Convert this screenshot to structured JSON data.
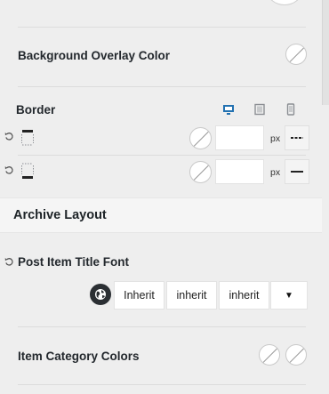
{
  "background_overlay": {
    "label": "Background Overlay Color"
  },
  "border": {
    "label": "Border",
    "devices": [
      "desktop-icon",
      "tablet-icon",
      "mobile-icon"
    ],
    "rows": [
      {
        "unit": "px",
        "style": "dashed"
      },
      {
        "unit": "px",
        "style": "solid"
      }
    ]
  },
  "archive_layout": {
    "title": "Archive Layout"
  },
  "post_item_title_font": {
    "label": "Post Item Title Font",
    "family": "Inherit",
    "weight": "inherit",
    "size": "inherit",
    "dropdown_icon": "▼"
  },
  "item_category_colors": {
    "label": "Item Category Colors"
  },
  "colors": {
    "accent": "#2271b1",
    "globe": "#2b2f33"
  }
}
